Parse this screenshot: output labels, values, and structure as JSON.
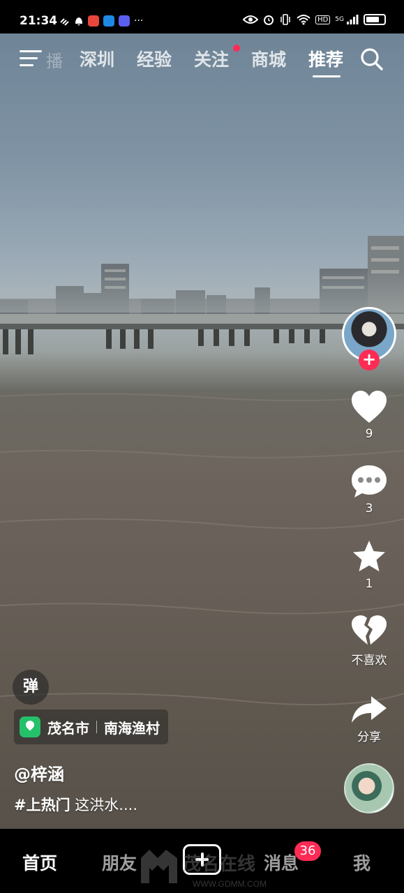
{
  "status_bar": {
    "time": "21:34",
    "more_indicator": "···",
    "network": "5G",
    "hd": "HD",
    "battery_level": 0.75
  },
  "top_nav": {
    "faded_tab": "播",
    "tabs": [
      {
        "label": "深圳"
      },
      {
        "label": "经验"
      },
      {
        "label": "关注"
      },
      {
        "label": "商城"
      },
      {
        "label": "推荐"
      }
    ],
    "active_tab": "推荐"
  },
  "actions": {
    "like_count": "9",
    "comment_count": "3",
    "favorite_count": "1",
    "dislike_label": "不喜欢",
    "share_label": "分享"
  },
  "danmaku_label": "弹",
  "location": {
    "city": "茂名市",
    "place": "南海渔村"
  },
  "post": {
    "username": "@梓涵",
    "hashtag": "#上热门",
    "text": "这洪水...."
  },
  "tab_bar": {
    "home": "首页",
    "friends": "朋友",
    "messages": "消息",
    "messages_badge": "36",
    "me": "我"
  },
  "watermark": {
    "text": "茂名在线",
    "url": "WWW.GDMM.COM"
  },
  "colors": {
    "accent": "#fe2c55",
    "location_pin": "#25c06a"
  }
}
